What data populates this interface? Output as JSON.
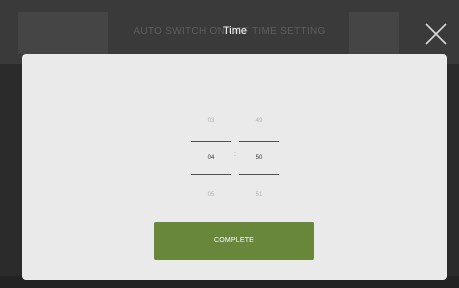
{
  "background": {
    "title": "AUTO SWITCH ON/OFF TIME SETTING"
  },
  "dialog": {
    "title": "Time",
    "close_icon": "close-icon",
    "hour": {
      "prev": "03",
      "selected": "04",
      "next": "05"
    },
    "minute": {
      "prev": "49",
      "selected": "50",
      "next": "51"
    },
    "separator": ":",
    "complete_label": "COMPLETE"
  },
  "colors": {
    "dialog_background": "#eaeaea",
    "button_green": "#69873b",
    "overlay_dark": "#2b2b2b"
  }
}
